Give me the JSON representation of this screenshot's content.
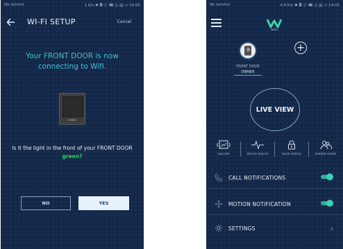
{
  "colors": {
    "background": "#14284a",
    "accent": "#3fc2d4",
    "green": "#34d058",
    "toggle_on": "#3bd0b6"
  },
  "wifi_setup": {
    "status_bar": {
      "left": "No service",
      "right": "1 K/s ✱ ◘ ⓞ ☎ ◫ ▥ ▭ 14:05"
    },
    "title": "WI-FI SETUP",
    "cancel": "Cancel",
    "message": "Your FRONT DOOR is now connecting to Wifi.",
    "question": "Is it the light in the front of your FRONT DOOR",
    "question_highlight": "green?",
    "no": "NO",
    "yes": "YES"
  },
  "home": {
    "status_bar": {
      "left": "No service",
      "right": "4.4 K/s ✱ ◘ ⓞ ☎ ◫ ▥ ▭ 14:05"
    },
    "logo": "WITH",
    "device_name": "FRONT DOOR",
    "device_role": "OWNER",
    "live_view": "LIVE VIEW",
    "quick_actions": [
      {
        "label": "GALLERY",
        "icon": "gallery-icon"
      },
      {
        "label": "DEVICE HEALTH",
        "icon": "heartbeat-icon"
      },
      {
        "label": "DOOR STATUS",
        "icon": "lock-icon"
      },
      {
        "label": "SHARED USERS",
        "icon": "users-icon"
      }
    ],
    "rows": [
      {
        "label": "CALL NOTIFICATIONS",
        "icon": "phone-icon",
        "toggle": true
      },
      {
        "label": "MOTION NOTIFICATION",
        "icon": "motion-icon",
        "toggle": true
      },
      {
        "label": "SETTINGS",
        "icon": "gear-icon",
        "toggle": false
      }
    ]
  }
}
